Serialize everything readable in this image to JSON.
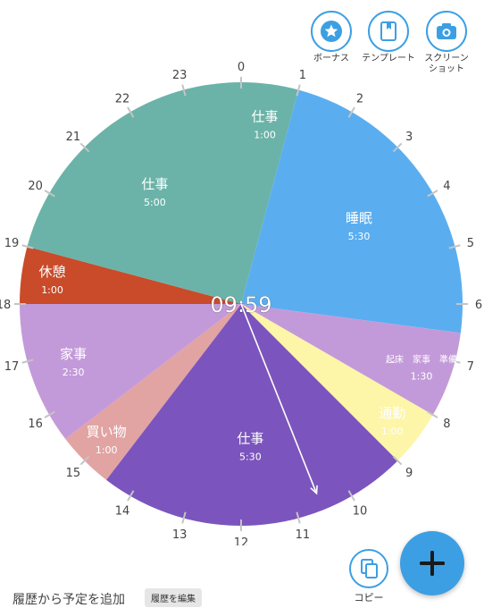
{
  "chart_data": {
    "type": "pie",
    "center_time": "09:59",
    "hour_labels": [
      "0",
      "1",
      "2",
      "3",
      "4",
      "5",
      "6",
      "7",
      "8",
      "9",
      "10",
      "11",
      "12",
      "13",
      "14",
      "15",
      "16",
      "17",
      "18",
      "19",
      "20",
      "21",
      "22",
      "23"
    ],
    "segments": [
      {
        "label": "仕事",
        "duration": "1:00",
        "start": 0,
        "end": 1,
        "color": "#6bb3a8"
      },
      {
        "label": "睡眠",
        "duration": "5:30",
        "start": 1,
        "end": 6.5,
        "color": "#5aaef0"
      },
      {
        "label": "起床　家事　準備",
        "duration": "1:30",
        "start": 6.5,
        "end": 8,
        "color": "#c39ad9"
      },
      {
        "label": "通勤",
        "duration": "1:00",
        "start": 8,
        "end": 9,
        "color": "#fdf5a8"
      },
      {
        "label": "仕事",
        "duration": "5:30",
        "start": 9,
        "end": 14.5,
        "color": "#7b55bd"
      },
      {
        "label": "買い物",
        "duration": "1:00",
        "start": 14.5,
        "end": 15.5,
        "color": "#e2a3a3"
      },
      {
        "label": "家事",
        "duration": "2:30",
        "start": 15.5,
        "end": 18,
        "color": "#c39ad9"
      },
      {
        "label": "休憩",
        "duration": "1:00",
        "start": 18,
        "end": 19,
        "color": "#c94b2a"
      },
      {
        "label": "仕事",
        "duration": "5:00",
        "start": 19,
        "end": 24,
        "color": "#6bb3a8"
      }
    ]
  },
  "toolbar": {
    "bonus_label": "ボーナス",
    "template_label": "テンプレート",
    "screenshot_label_1": "スクリーン",
    "screenshot_label_2": "ショット"
  },
  "bottom": {
    "copy_label": "コピー",
    "add_from_history": "履歴から予定を追加",
    "edit_history": "履歴を編集"
  },
  "colors": {
    "accent": "#3d9fe3"
  }
}
